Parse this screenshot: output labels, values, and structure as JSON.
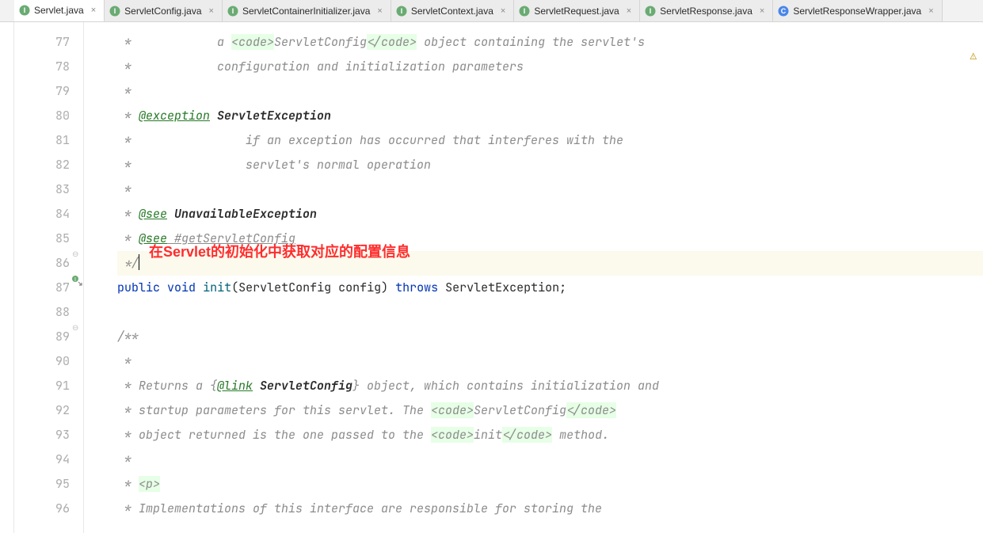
{
  "tabs": [
    {
      "name": "Servlet.java",
      "icon": "interface",
      "active": true
    },
    {
      "name": "ServletConfig.java",
      "icon": "interface",
      "active": false
    },
    {
      "name": "ServletContainerInitializer.java",
      "icon": "interface",
      "active": false
    },
    {
      "name": "ServletContext.java",
      "icon": "interface",
      "active": false
    },
    {
      "name": "ServletRequest.java",
      "icon": "interface",
      "active": false
    },
    {
      "name": "ServletResponse.java",
      "icon": "interface",
      "active": false
    },
    {
      "name": "ServletResponseWrapper.java",
      "icon": "class",
      "active": false
    }
  ],
  "line_numbers": [
    "77",
    "78",
    "79",
    "80",
    "81",
    "82",
    "83",
    "84",
    "85",
    "86",
    "87",
    "88",
    "89",
    "90",
    "91",
    "92",
    "93",
    "94",
    "95",
    "96"
  ],
  "annotation_text": "在Servlet的初始化中获取对应的配置信息",
  "code": {
    "l77": {
      "prefix": " *            a ",
      "hl1": "<code>",
      "mid": "ServletConfig",
      "hl2": "</code>",
      "rest": " object containing the servlet's"
    },
    "l78": {
      "prefix": " *            configuration and initialization parameters"
    },
    "l79": {
      "text": " *"
    },
    "l80": {
      "prefix": " * ",
      "tag": "@exception",
      "name": " ServletException"
    },
    "l81": {
      "text": " *                if an exception has occurred that interferes with the"
    },
    "l82": {
      "text": " *                servlet's normal operation"
    },
    "l83": {
      "text": " *"
    },
    "l84": {
      "prefix": " * ",
      "tag": "@see",
      "name": " UnavailableException"
    },
    "l85": {
      "prefix": " * ",
      "tag": "@see",
      "link": " #getServletConfig"
    },
    "l86": {
      "text": " */"
    },
    "l87": {
      "kw1": "public",
      "kw2": "void",
      "method": "init",
      "sig1": "(ServletConfig config) ",
      "kw3": "throws",
      "sig2": " ServletException;"
    },
    "l88": {
      "text": ""
    },
    "l89": {
      "text": "/**"
    },
    "l90": {
      "text": " *"
    },
    "l91": {
      "prefix": " * Returns a {",
      "tag": "@link",
      "name": " ServletConfig",
      "rest": "} object, which contains initialization and"
    },
    "l92": {
      "prefix": " * startup parameters for this servlet. The ",
      "hl1": "<code>",
      "mid": "ServletConfig",
      "hl2": "</code>"
    },
    "l93": {
      "prefix": " * object returned is the one passed to the ",
      "hl1": "<code>",
      "mid": "init",
      "hl2": "</code>",
      "rest": " method."
    },
    "l94": {
      "text": " *"
    },
    "l95": {
      "prefix": " * ",
      "hl1": "<p>"
    },
    "l96": {
      "text": " * Implementations of this interface are responsible for storing the"
    }
  }
}
